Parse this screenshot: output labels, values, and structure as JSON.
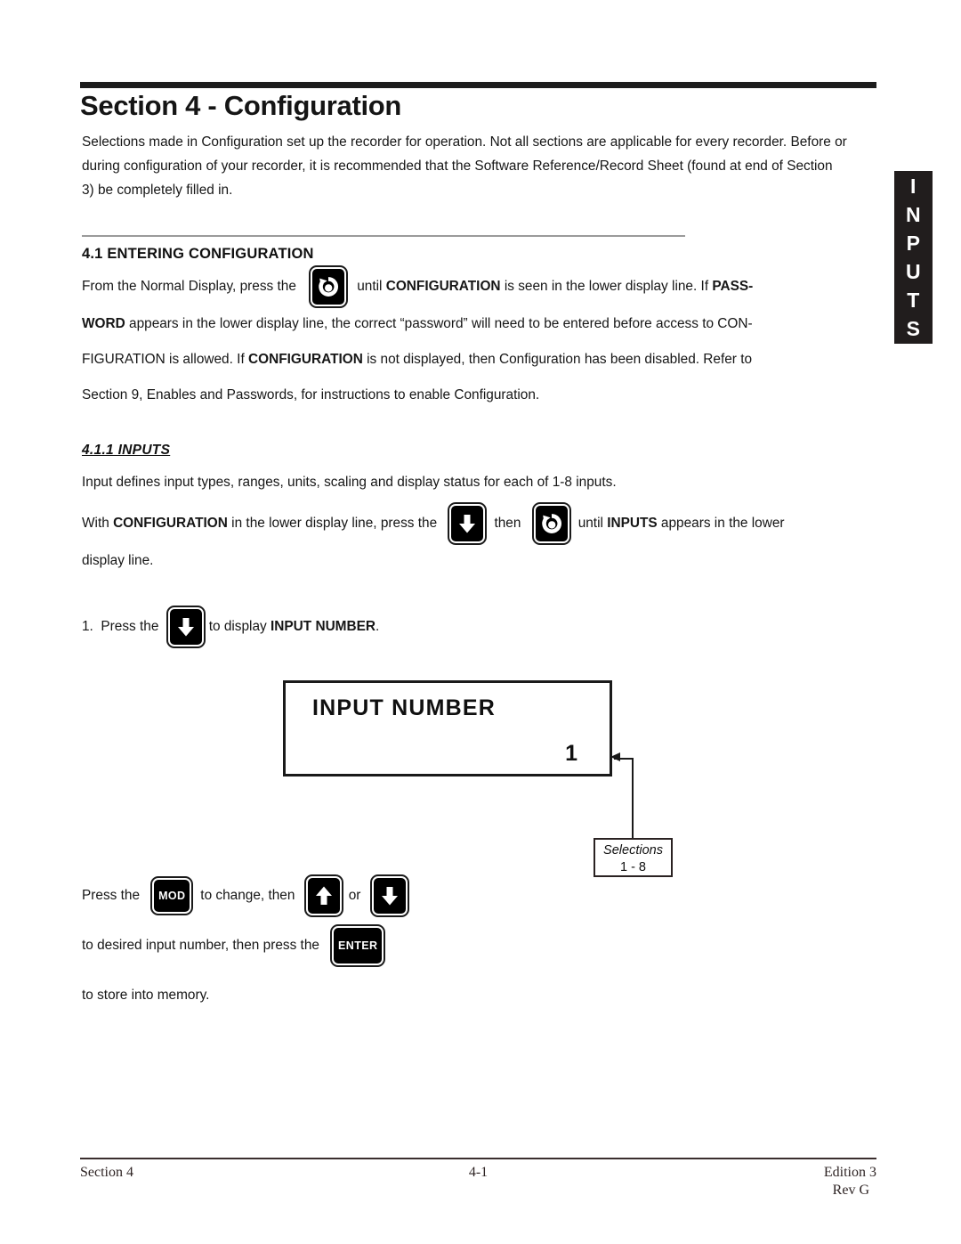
{
  "page": {
    "section_title": "Section 4 - Configuration",
    "intro_paragraph": "Selections made in Configuration set up the recorder for operation.  Not all sections are applicable for every recorder.  Before or during configuration of your recorder, it is recommended that the Software Reference/Record Sheet (found at end of Section 3) be completely filled in."
  },
  "side_tab": {
    "label": "INPUTS",
    "letters": [
      "I",
      "N",
      "P",
      "U",
      "T",
      "S"
    ],
    "background": "#211d1d",
    "color": "#ffffff"
  },
  "section_41": {
    "heading": "4.1 ENTERING CONFIGURATION",
    "text_before_key": "From  the  Normal  Display,  press  the",
    "text_after_key_1": "until ",
    "bold_configuration": "CONFIGURATION",
    "text_after_key_2": " is seen in the lower display line.  If  ",
    "bold_pass": "PASS-",
    "bold_word": "WORD",
    "text_line2": " appears in the lower display line, the correct “password” will need to be entered before access to CON-",
    "text_line3_a": "FIGURATION is allowed.  If ",
    "bold_configuration_2": "CONFIGURATION",
    "text_line3_b": " is not displayed, then Configuration has been disabled.  Refer to",
    "text_line4": "Section 9, Enables and Passwords, for instructions to enable Configuration."
  },
  "section_411": {
    "heading": "4.1.1  INPUTS",
    "definition": "Input defines input types, ranges, units, scaling and display status for each of 1-8 inputs.",
    "with_config_a": "With ",
    "bold_configuration": "CONFIGURATION",
    "with_config_b": " in the lower display line, press the",
    "then_label": "then",
    "until_a": "until ",
    "bold_inputs": "INPUTS",
    "until_b": " appears in the lower",
    "display_line_text": "display line."
  },
  "step1": {
    "number": "1.",
    "text_before": "Press the",
    "text_after": "to display ",
    "bold_target": "INPUT NUMBER",
    "period": "."
  },
  "display": {
    "line1": "INPUT  NUMBER",
    "line2": "1"
  },
  "callout": {
    "title": "Selections",
    "range": "1 - 8"
  },
  "instruction": {
    "press_the": "Press  the",
    "to_change_then": "to change, then",
    "or": "or",
    "line2": "to desired input number, then press the",
    "line3": "to store into memory."
  },
  "keys": {
    "display_scroll": {
      "name": "display-scroll-key",
      "icon": "circular-arrow-icon",
      "label": ""
    },
    "down_arrow": {
      "name": "down-arrow-key",
      "icon": "arrow-down-icon",
      "label": ""
    },
    "up_arrow": {
      "name": "up-arrow-key",
      "icon": "arrow-up-icon",
      "label": ""
    },
    "mod": {
      "name": "mod-key",
      "icon": "",
      "label": "MOD"
    },
    "enter": {
      "name": "enter-key",
      "icon": "",
      "label": "ENTER"
    }
  },
  "footer": {
    "left": "Section 4",
    "center": "4-1",
    "right_line1": "Edition 3",
    "right_line2": "Rev  G"
  }
}
